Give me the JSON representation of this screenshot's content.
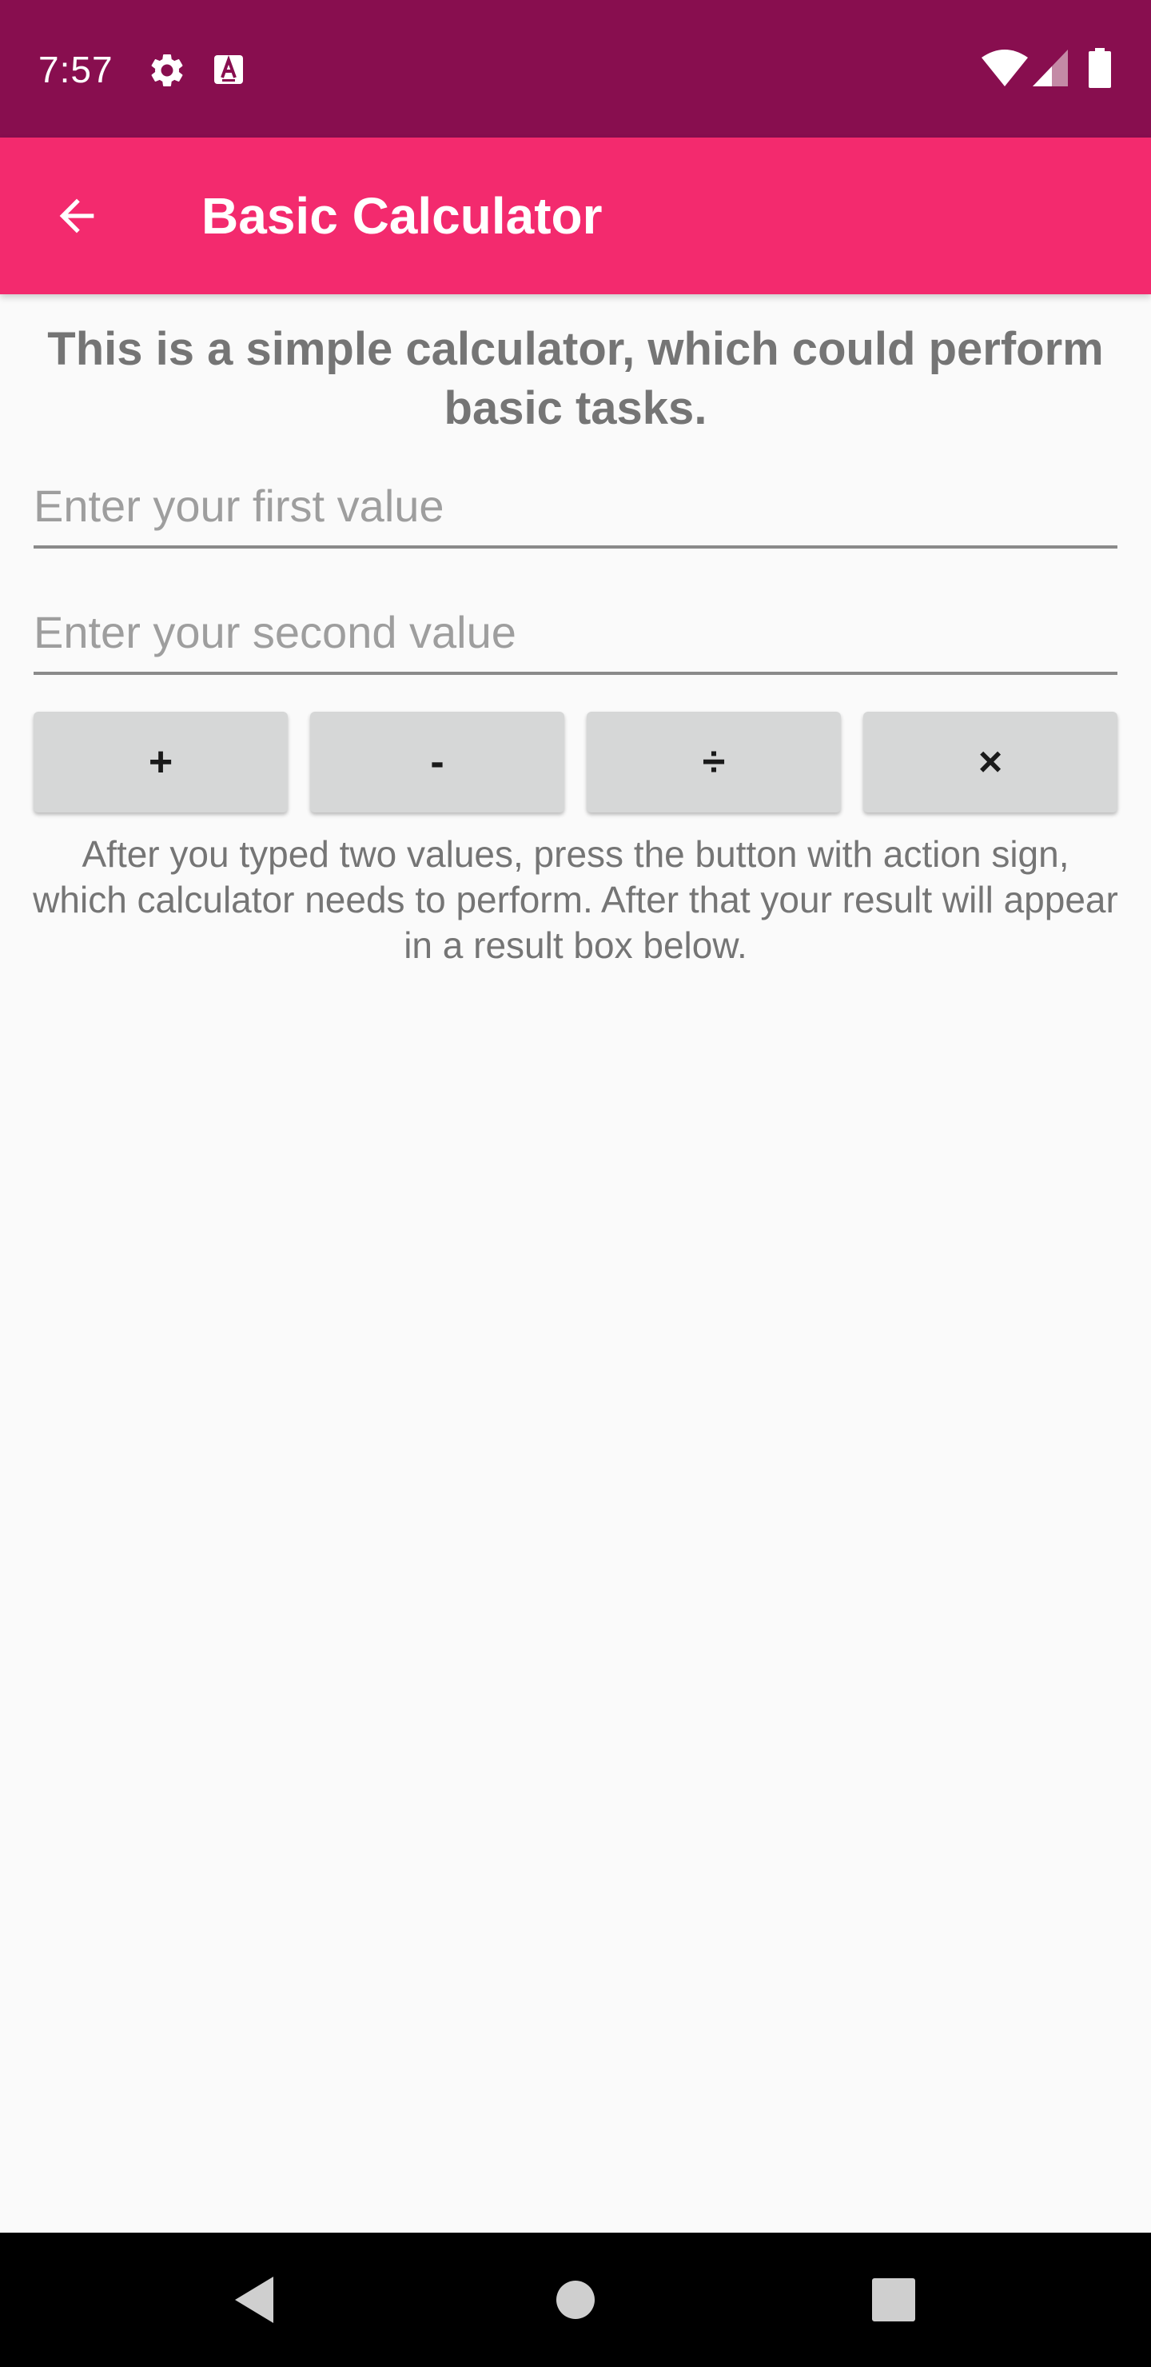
{
  "status_bar": {
    "time": "7:57",
    "icons": [
      "gear-icon",
      "keyboard-a-icon",
      "wifi-icon",
      "signal-icon",
      "battery-icon"
    ]
  },
  "app_bar": {
    "back_icon": "arrow-back-icon",
    "title": "Basic Calculator"
  },
  "main": {
    "intro_text": "This is a simple calculator, which could perform basic tasks.",
    "first_input": {
      "value": "",
      "placeholder": "Enter your first value"
    },
    "second_input": {
      "value": "",
      "placeholder": "Enter your second value"
    },
    "operations": [
      {
        "label": "+"
      },
      {
        "label": "-"
      },
      {
        "label": "÷"
      },
      {
        "label": "×"
      }
    ],
    "instructions": "After you typed two values, press the button with action sign, which calculator needs to perform. After that your result will appear in a result box below."
  },
  "nav_bar": {
    "icons": [
      "back-triangle-icon",
      "home-circle-icon",
      "recents-square-icon"
    ]
  },
  "colors": {
    "status_bar": "#880e4f",
    "app_bar": "#f32a6e",
    "background": "#fafafa",
    "button": "#d6d7d7"
  }
}
